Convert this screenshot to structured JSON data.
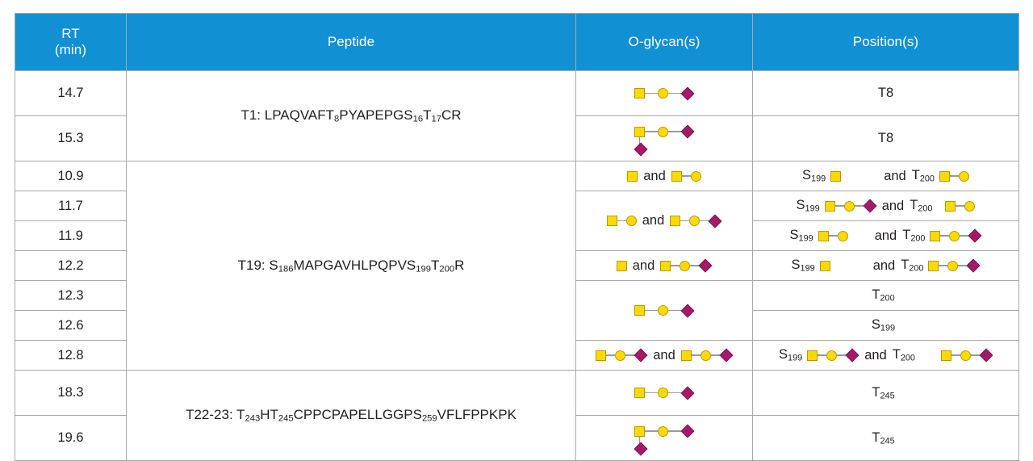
{
  "table": {
    "headers": {
      "rt_line1": "RT",
      "rt_line2": "(min)",
      "peptide": "Peptide",
      "oglycan": "O-glycan(s)",
      "position": "Position(s)"
    },
    "colors": {
      "header_bg": "#1290d4",
      "header_text": "#ffffff",
      "grid_line": "#a7a9ac",
      "glycan_yellow": "#ffd900",
      "glycan_yellow_border": "#b59a00",
      "glycan_magenta": "#a51a68",
      "glycan_magenta_border": "#7d1450",
      "linkage_line": "#9a9a9a"
    },
    "symbol_legend": {
      "yellow_square": "GalNAc",
      "yellow_circle": "Gal",
      "magenta_diamond": "NeuAc"
    },
    "conjunction": "and",
    "rt_values": [
      "14.7",
      "15.3",
      "10.9",
      "11.7",
      "11.9",
      "12.2",
      "12.3",
      "12.6",
      "12.8",
      "18.3",
      "19.6"
    ],
    "peptides": [
      {
        "prefix": "T1: LPAQVAFT",
        "sub1": "8",
        "mid1": "PYAPEPGS",
        "sub2": "16",
        "mid2": "T",
        "sub3": "17",
        "suffix": "CR"
      },
      {
        "prefix": "T19: S",
        "sub1": "186",
        "mid1": "MAPGAVHLPQPVS",
        "sub2": "199",
        "mid2": "T",
        "sub3": "200",
        "suffix": "R"
      },
      {
        "prefix": "T22-23: T",
        "sub1": "243",
        "mid1": "HT",
        "sub2": "245",
        "mid2": "CPPCPAPELLGGPS",
        "sub3": "259",
        "suffix": "VFLFPPKPK"
      }
    ],
    "positions": {
      "t8": "T8",
      "s199_base": "S",
      "s199_sub": "199",
      "t200_base": "T",
      "t200_sub": "200",
      "t245_base": "T",
      "t245_sub": "245"
    },
    "glycan_structures": {
      "gn": "GalNAc",
      "gn_gal": "GalNAc-Gal",
      "gn_gal_neu": "GalNAc-Gal-NeuAc",
      "gn_gal_neu_branched": "GalNAc(-NeuAc)-Gal-NeuAc"
    },
    "rows": [
      {
        "rt": "14.7",
        "glycans": [
          "gn_gal_neu"
        ],
        "position_text": "T8"
      },
      {
        "rt": "15.3",
        "glycans": [
          "gn_gal_neu_branched"
        ],
        "position_text": "T8"
      },
      {
        "rt": "10.9",
        "glycans": [
          "gn",
          "gn_gal"
        ],
        "position_glycans": [
          "gn",
          "gn_gal"
        ]
      },
      {
        "rt": "11.7",
        "glycans": [
          "gn_gal",
          "gn_gal_neu"
        ],
        "position_glycans": [
          "gn_gal_neu",
          "gn_gal"
        ]
      },
      {
        "rt": "11.9",
        "glycans": [
          "gn_gal",
          "gn_gal_neu"
        ],
        "position_glycans": [
          "gn_gal",
          "gn_gal_neu"
        ]
      },
      {
        "rt": "12.2",
        "glycans": [
          "gn",
          "gn_gal_neu"
        ],
        "position_glycans": [
          "gn",
          "gn_gal_neu"
        ]
      },
      {
        "rt": "12.3",
        "glycans": [
          "gn_gal_neu"
        ],
        "position_text": "T200"
      },
      {
        "rt": "12.6",
        "glycans": [
          "gn_gal_neu"
        ],
        "position_text": "S199"
      },
      {
        "rt": "12.8",
        "glycans": [
          "gn_gal_neu",
          "gn_gal_neu"
        ],
        "position_glycans": [
          "gn_gal_neu",
          "gn_gal_neu"
        ]
      },
      {
        "rt": "18.3",
        "glycans": [
          "gn_gal_neu"
        ],
        "position_text": "T245"
      },
      {
        "rt": "19.6",
        "glycans": [
          "gn_gal_neu_branched"
        ],
        "position_text": "T245"
      }
    ]
  }
}
